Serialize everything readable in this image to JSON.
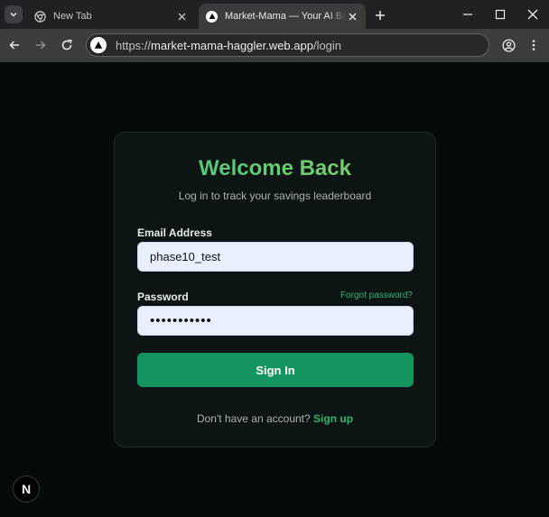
{
  "browser": {
    "tabs": [
      {
        "title": "New Tab",
        "active": false
      },
      {
        "title": "Market-Mama — Your AI Bargain",
        "active": true
      }
    ],
    "url": {
      "scheme": "https://",
      "host": "market-mama-haggler.web.app",
      "path": "/login"
    }
  },
  "login": {
    "title": "Welcome Back",
    "subtitle": "Log in to track your savings leaderboard",
    "email_label": "Email Address",
    "email_value": "phase10_test",
    "password_label": "Password",
    "password_value": "•••••••••••",
    "forgot_label": "Forgot password?",
    "submit_label": "Sign In",
    "signup_prompt": "Don't have an account?",
    "signup_label": "Sign up"
  },
  "badge": {
    "letter": "N"
  },
  "colors": {
    "accent": "#14955f",
    "link": "#2fb573",
    "background": "#050a0a",
    "card": "#0c1414",
    "input_bg": "#e8f0fe"
  }
}
